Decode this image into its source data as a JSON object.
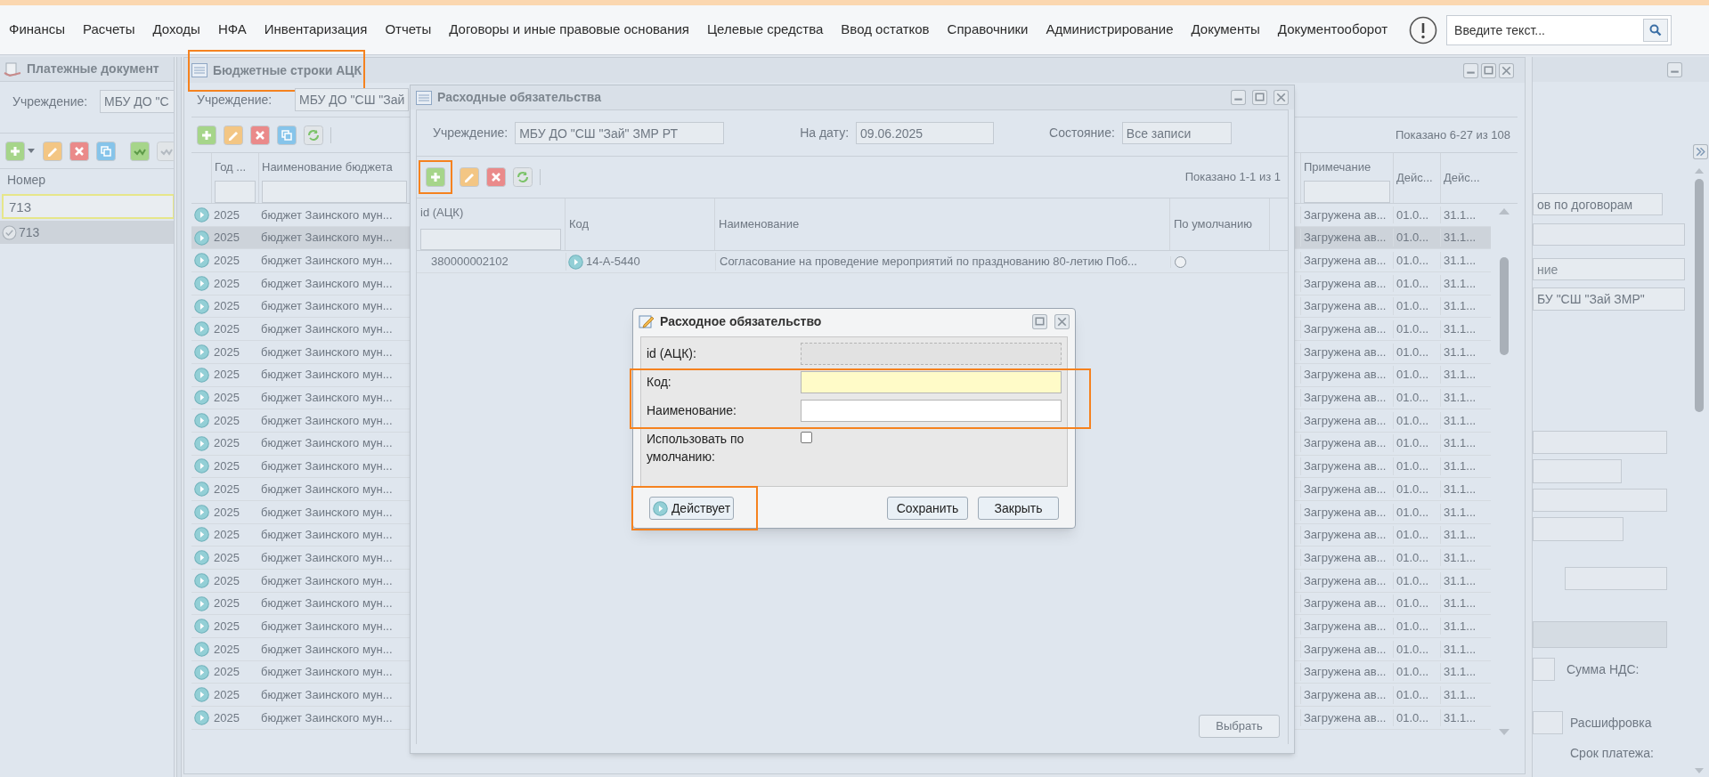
{
  "menu": {
    "items": [
      "Финансы",
      "Расчеты",
      "Доходы",
      "НФА",
      "Инвентаризация",
      "Отчеты",
      "Договоры и иные правовые основания",
      "Целевые средства",
      "Ввод остатков",
      "Справочники",
      "Администрирование",
      "Документы",
      "Документооборот"
    ],
    "search": {
      "placeholder": "Введите текст..."
    }
  },
  "payment_window": {
    "title": "Платежные документ",
    "institution_label": "Учреждение:",
    "institution_value": "МБУ ДО \"С",
    "toolbar": [
      {
        "kind": "add_menu",
        "disabled": false
      },
      {
        "kind": "edit",
        "disabled": false
      },
      {
        "kind": "delete",
        "disabled": false
      },
      {
        "kind": "copy",
        "disabled": false
      },
      {
        "kind": "sign",
        "disabled": false
      },
      {
        "kind": "sign",
        "disabled": true
      }
    ],
    "column": "Номер",
    "filter_value": "713",
    "rows": [
      {
        "number": "713",
        "selected": true
      }
    ]
  },
  "budget_window": {
    "title": "Бюджетные строки АЦК",
    "title_highlighted": true,
    "institution_label": "Учреждение:",
    "institution_value": "МБУ ДО \"СШ \"Зай",
    "toolbar": [
      {
        "kind": "add",
        "disabled": false
      },
      {
        "kind": "edit",
        "disabled": false
      },
      {
        "kind": "delete",
        "disabled": false
      },
      {
        "kind": "copy",
        "disabled": false
      },
      {
        "kind": "refresh",
        "disabled": false
      }
    ],
    "paging": "Показано 6-27 из 108",
    "columns": [
      "Год ...",
      "Наименование бюджета",
      "Примечание",
      "Дейс...",
      "Дейс..."
    ],
    "rows": [
      {
        "year": "2025",
        "budget": "бюджет Заинского мун...",
        "note": "Загружена ав...",
        "start": "01.0...",
        "end": "31.1...",
        "selected": false
      },
      {
        "year": "2025",
        "budget": "бюджет Заинского мун...",
        "note": "Загружена ав...",
        "start": "01.0...",
        "end": "31.1...",
        "selected": true
      },
      {
        "year": "2025",
        "budget": "бюджет Заинского мун...",
        "note": "Загружена ав...",
        "start": "01.0...",
        "end": "31.1...",
        "selected": false
      },
      {
        "year": "2025",
        "budget": "бюджет Заинского мун...",
        "note": "Загружена ав...",
        "start": "01.0...",
        "end": "31.1...",
        "selected": false
      },
      {
        "year": "2025",
        "budget": "бюджет Заинского мун...",
        "note": "Загружена ав...",
        "start": "01.0...",
        "end": "31.1...",
        "selected": false
      },
      {
        "year": "2025",
        "budget": "бюджет Заинского мун...",
        "note": "Загружена ав...",
        "start": "01.0...",
        "end": "31.1...",
        "selected": false
      },
      {
        "year": "2025",
        "budget": "бюджет Заинского мун...",
        "note": "Загружена ав...",
        "start": "01.0...",
        "end": "31.1...",
        "selected": false
      },
      {
        "year": "2025",
        "budget": "бюджет Заинского мун...",
        "note": "Загружена ав...",
        "start": "01.0...",
        "end": "31.1...",
        "selected": false
      },
      {
        "year": "2025",
        "budget": "бюджет Заинского мун...",
        "note": "Загружена ав...",
        "start": "01.0...",
        "end": "31.1...",
        "selected": false
      },
      {
        "year": "2025",
        "budget": "бюджет Заинского мун...",
        "note": "Загружена ав...",
        "start": "01.0...",
        "end": "31.1...",
        "selected": false
      },
      {
        "year": "2025",
        "budget": "бюджет Заинского мун...",
        "note": "Загружена ав...",
        "start": "01.0...",
        "end": "31.1...",
        "selected": false
      },
      {
        "year": "2025",
        "budget": "бюджет Заинского мун...",
        "note": "Загружена ав...",
        "start": "01.0...",
        "end": "31.1...",
        "selected": false
      },
      {
        "year": "2025",
        "budget": "бюджет Заинского мун...",
        "note": "Загружена ав...",
        "start": "01.0...",
        "end": "31.1...",
        "selected": false
      },
      {
        "year": "2025",
        "budget": "бюджет Заинского мун...",
        "note": "Загружена ав...",
        "start": "01.0...",
        "end": "31.1...",
        "selected": false
      },
      {
        "year": "2025",
        "budget": "бюджет Заинского мун...",
        "note": "Загружена ав...",
        "start": "01.0...",
        "end": "31.1...",
        "selected": false
      },
      {
        "year": "2025",
        "budget": "бюджет Заинского мун...",
        "note": "Загружена ав...",
        "start": "01.0...",
        "end": "31.1...",
        "selected": false
      },
      {
        "year": "2025",
        "budget": "бюджет Заинского мун...",
        "note": "Загружена ав...",
        "start": "01.0...",
        "end": "31.1...",
        "selected": false
      },
      {
        "year": "2025",
        "budget": "бюджет Заинского мун...",
        "note": "Загружена ав...",
        "start": "01.0...",
        "end": "31.1...",
        "selected": false
      },
      {
        "year": "2025",
        "budget": "бюджет Заинского мун...",
        "note": "Загружена ав...",
        "start": "01.0...",
        "end": "31.1...",
        "selected": false
      },
      {
        "year": "2025",
        "budget": "бюджет Заинского мун...",
        "note": "Загружена ав...",
        "start": "01.0...",
        "end": "31.1...",
        "selected": false
      },
      {
        "year": "2025",
        "budget": "бюджет Заинского мун...",
        "note": "Загружена ав...",
        "start": "01.0...",
        "end": "31.1...",
        "selected": false
      },
      {
        "year": "2025",
        "budget": "бюджет Заинского мун...",
        "note": "Загружена ав...",
        "start": "01.0...",
        "end": "31.1...",
        "selected": false
      },
      {
        "year": "2025",
        "budget": "бюджет Заинского мун...",
        "note": "Загружена ав...",
        "start": "01.0...",
        "end": "31.1...",
        "selected": false
      }
    ]
  },
  "expense_window": {
    "title": "Расходные обязательства",
    "filters": [
      {
        "label": "Учреждение:",
        "value": "МБУ ДО \"СШ \"Зай\" ЗМР РТ"
      },
      {
        "label": "На дату:",
        "value": "09.06.2025"
      },
      {
        "label": "Состояние:",
        "value": "Все записи"
      }
    ],
    "toolbar": [
      {
        "kind": "add",
        "disabled": false,
        "highlighted": true
      },
      {
        "kind": "edit",
        "disabled": false,
        "highlighted": false
      },
      {
        "kind": "delete",
        "disabled": false,
        "highlighted": false
      },
      {
        "kind": "refresh",
        "disabled": false,
        "highlighted": false
      }
    ],
    "paging": "Показано 1-1 из 1",
    "columns": [
      "id (АЦК)",
      "Код",
      "Наименование",
      "По умолчанию"
    ],
    "rows": [
      {
        "id": "380000002102",
        "code": "14-А-5440",
        "name": "Согласование на проведение мероприятий по празднованию 80-летию Поб...",
        "default": false
      }
    ],
    "select_button": "Выбрать"
  },
  "dialog": {
    "title": "Расходное обязательство",
    "fields": [
      {
        "kind": "text",
        "label": "id (АЦК):",
        "disabled": true,
        "required": false,
        "highlighted": false
      },
      {
        "kind": "text",
        "label": "Код:",
        "disabled": false,
        "required": true,
        "highlighted": true
      },
      {
        "kind": "text",
        "label": "Наименование:",
        "disabled": false,
        "required": false,
        "highlighted": true
      },
      {
        "kind": "checkbox",
        "label": "Использовать по умолчанию:",
        "checked": false,
        "highlighted": false
      }
    ],
    "status_button": {
      "label": "Действует",
      "highlighted": true
    },
    "buttons": [
      "Сохранить",
      "Закрыть"
    ]
  },
  "right_window": {
    "contract_field": "ов по договорам",
    "hint_field": {
      "placeholder": "ние"
    },
    "institution_field": "БУ \"СШ \"Зай ЗМР\"",
    "vat_label": "Сумма НДС:",
    "breakdown_label": "Расшифровка",
    "due_label": "Срок платежа:"
  }
}
